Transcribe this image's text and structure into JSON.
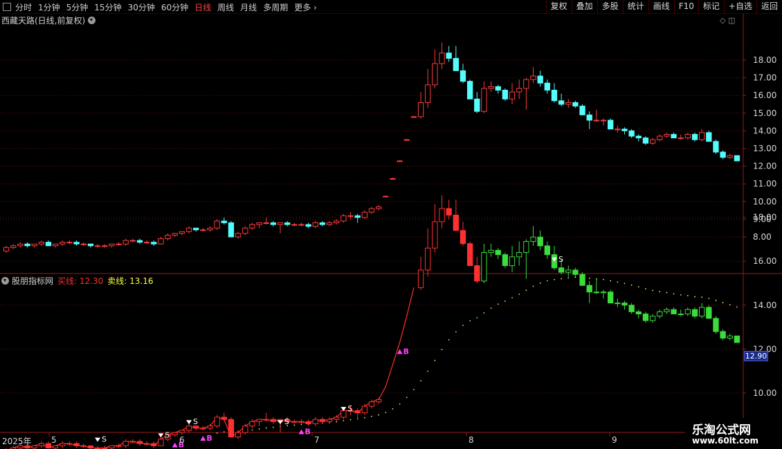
{
  "toolbar": {
    "periods": [
      "分时",
      "1分钟",
      "5分钟",
      "15分钟",
      "30分钟",
      "60分钟",
      "日线",
      "周线",
      "月线",
      "多周期",
      "更多"
    ],
    "active_period": "日线",
    "more_arrow": "›",
    "buttons": [
      "复权",
      "叠加",
      "多股",
      "统计",
      "画线",
      "F10",
      "标记",
      "+自选",
      "返回"
    ]
  },
  "main_panel": {
    "title": "西藏天路(日线,前复权)",
    "icons": [
      "diamond-icon",
      "window-icon"
    ],
    "y_ticks": [
      "18.00",
      "17.00",
      "16.00",
      "15.00",
      "14.00",
      "13.00",
      "12.00",
      "11.00",
      "10.00",
      "9.00",
      "8.00"
    ]
  },
  "indicator_panel": {
    "name": "股朋指标网",
    "buy_label": "买线:",
    "buy_value": "12.30",
    "sell_label": "卖线:",
    "sell_value": "13.16",
    "y_ticks": [
      "18.00",
      "16.00",
      "14.00",
      "12.00",
      "10.00"
    ],
    "current_tag": "12.90",
    "signal_labels": {
      "buy": "B",
      "sell": "S"
    }
  },
  "date_axis": {
    "labels": [
      "2025年",
      "5",
      "6",
      "7",
      "8",
      "9"
    ]
  },
  "watermark": {
    "line1": "乐淘公式网",
    "line2": "www.60lt.com"
  },
  "colors": {
    "up": "#ff3c3c",
    "down": "#54fcfc",
    "ind_up": "#ff3030",
    "ind_down": "#3cdc3c",
    "grid": "#7a1010",
    "signal_buy": "#ff40ff",
    "signal_sell": "#ffffff"
  },
  "chart_data": {
    "type": "candlestick",
    "title": "西藏天路(日线,前复权)",
    "y_range": [
      7.0,
      19.5
    ],
    "ohlc": [
      [
        7.2,
        7.5,
        7.1,
        7.4
      ],
      [
        7.4,
        7.6,
        7.3,
        7.5
      ],
      [
        7.5,
        7.7,
        7.4,
        7.6
      ],
      [
        7.6,
        7.7,
        7.4,
        7.5
      ],
      [
        7.5,
        7.6,
        7.4,
        7.6
      ],
      [
        7.6,
        7.8,
        7.5,
        7.7
      ],
      [
        7.7,
        7.8,
        7.5,
        7.5
      ],
      [
        7.5,
        7.6,
        7.4,
        7.6
      ],
      [
        7.6,
        7.8,
        7.5,
        7.7
      ],
      [
        7.7,
        7.8,
        7.6,
        7.7
      ],
      [
        7.7,
        7.8,
        7.5,
        7.6
      ],
      [
        7.6,
        7.7,
        7.5,
        7.6
      ],
      [
        7.6,
        7.6,
        7.4,
        7.5
      ],
      [
        7.5,
        7.6,
        7.4,
        7.5
      ],
      [
        7.5,
        7.6,
        7.4,
        7.5
      ],
      [
        7.5,
        7.6,
        7.4,
        7.6
      ],
      [
        7.6,
        7.7,
        7.5,
        7.6
      ],
      [
        7.6,
        7.9,
        7.5,
        7.8
      ],
      [
        7.8,
        7.9,
        7.7,
        7.8
      ],
      [
        7.8,
        7.9,
        7.6,
        7.7
      ],
      [
        7.7,
        7.8,
        7.6,
        7.7
      ],
      [
        7.7,
        7.8,
        7.5,
        7.6
      ],
      [
        7.6,
        8.0,
        7.6,
        7.9
      ],
      [
        7.9,
        8.2,
        7.8,
        8.1
      ],
      [
        8.1,
        8.2,
        8.0,
        8.2
      ],
      [
        8.2,
        8.3,
        8.1,
        8.3
      ],
      [
        8.3,
        8.6,
        8.2,
        8.5
      ],
      [
        8.5,
        8.5,
        8.3,
        8.4
      ],
      [
        8.4,
        8.5,
        8.3,
        8.4
      ],
      [
        8.4,
        8.6,
        8.3,
        8.5
      ],
      [
        8.5,
        9.0,
        8.4,
        8.9
      ],
      [
        8.9,
        9.1,
        8.7,
        8.8
      ],
      [
        8.8,
        8.9,
        8.1,
        8.0
      ],
      [
        8.0,
        8.3,
        7.9,
        8.2
      ],
      [
        8.2,
        8.6,
        8.1,
        8.5
      ],
      [
        8.5,
        8.8,
        8.4,
        8.7
      ],
      [
        8.7,
        8.8,
        8.5,
        8.8
      ],
      [
        8.8,
        9.1,
        8.7,
        8.8
      ],
      [
        8.8,
        8.9,
        8.6,
        8.7
      ],
      [
        8.7,
        8.8,
        8.2,
        8.8
      ],
      [
        8.8,
        8.9,
        8.6,
        8.7
      ],
      [
        8.7,
        8.8,
        8.6,
        8.7
      ],
      [
        8.7,
        8.8,
        8.6,
        8.7
      ],
      [
        8.7,
        8.8,
        8.5,
        8.6
      ],
      [
        8.6,
        8.9,
        8.5,
        8.8
      ],
      [
        8.8,
        8.9,
        8.6,
        8.7
      ],
      [
        8.7,
        8.9,
        8.6,
        8.8
      ],
      [
        8.8,
        9.0,
        8.7,
        8.9
      ],
      [
        8.9,
        9.3,
        8.8,
        9.2
      ],
      [
        9.2,
        9.4,
        9.0,
        9.2
      ],
      [
        9.2,
        9.3,
        8.8,
        9.1
      ],
      [
        9.1,
        9.5,
        9.0,
        9.4
      ],
      [
        9.4,
        9.7,
        9.3,
        9.6
      ],
      [
        9.6,
        9.8,
        9.5,
        9.7
      ],
      [
        10.3,
        10.35,
        10.25,
        10.3
      ],
      [
        11.3,
        11.35,
        11.25,
        11.3
      ],
      [
        12.3,
        12.35,
        12.25,
        12.3
      ],
      [
        13.5,
        13.55,
        13.45,
        13.5
      ],
      [
        14.8,
        14.85,
        14.75,
        14.8
      ],
      [
        14.8,
        16.2,
        14.7,
        15.6
      ],
      [
        15.6,
        17.5,
        15.3,
        16.6
      ],
      [
        16.6,
        18.6,
        16.4,
        17.8
      ],
      [
        17.8,
        19.0,
        17.5,
        18.4
      ],
      [
        18.4,
        18.8,
        17.9,
        18.1
      ],
      [
        18.1,
        18.8,
        17.4,
        17.4
      ],
      [
        17.4,
        17.8,
        16.7,
        16.8
      ],
      [
        16.8,
        16.9,
        15.8,
        15.8
      ],
      [
        15.8,
        16.2,
        15.0,
        15.1
      ],
      [
        15.1,
        16.8,
        15.0,
        16.4
      ],
      [
        16.4,
        16.8,
        16.2,
        16.5
      ],
      [
        16.5,
        16.6,
        16.1,
        16.3
      ],
      [
        16.3,
        16.4,
        15.7,
        15.8
      ],
      [
        15.8,
        16.7,
        15.5,
        16.2
      ],
      [
        16.2,
        16.9,
        15.8,
        16.4
      ],
      [
        16.4,
        17.0,
        15.2,
        16.9
      ],
      [
        16.9,
        17.6,
        16.7,
        17.1
      ],
      [
        17.1,
        17.4,
        16.5,
        16.7
      ],
      [
        16.7,
        16.9,
        16.1,
        16.3
      ],
      [
        16.3,
        16.7,
        15.6,
        15.7
      ],
      [
        15.7,
        16.1,
        15.4,
        15.5
      ],
      [
        15.5,
        15.8,
        15.3,
        15.6
      ],
      [
        15.6,
        15.7,
        15.3,
        15.4
      ],
      [
        15.4,
        15.5,
        14.9,
        14.9
      ],
      [
        14.9,
        15.1,
        14.1,
        14.6
      ],
      [
        14.6,
        15.2,
        14.5,
        14.6
      ],
      [
        14.6,
        14.7,
        14.3,
        14.6
      ],
      [
        14.6,
        14.7,
        14.1,
        14.1
      ],
      [
        14.1,
        14.3,
        13.9,
        14.1
      ],
      [
        14.1,
        14.2,
        13.8,
        14.0
      ],
      [
        14.0,
        14.1,
        13.6,
        13.7
      ],
      [
        13.7,
        13.8,
        13.4,
        13.6
      ],
      [
        13.6,
        13.7,
        13.2,
        13.3
      ],
      [
        13.3,
        13.6,
        13.2,
        13.5
      ],
      [
        13.5,
        13.8,
        13.4,
        13.7
      ],
      [
        13.7,
        13.9,
        13.6,
        13.8
      ],
      [
        13.8,
        13.9,
        13.6,
        13.6
      ],
      [
        13.6,
        13.8,
        13.5,
        13.6
      ],
      [
        13.6,
        13.9,
        13.5,
        13.8
      ],
      [
        13.8,
        13.9,
        13.4,
        13.5
      ],
      [
        13.5,
        14.1,
        13.4,
        13.9
      ],
      [
        13.9,
        14.0,
        13.4,
        13.4
      ],
      [
        13.4,
        13.5,
        12.7,
        12.8
      ],
      [
        12.8,
        12.9,
        12.4,
        12.5
      ],
      [
        12.5,
        12.7,
        12.4,
        12.6
      ],
      [
        12.6,
        12.6,
        12.3,
        12.3
      ]
    ],
    "indicator": {
      "buy_line": 12.3,
      "sell_line": 13.16,
      "current": 12.9,
      "sell_signals_at": [
        13,
        22,
        26,
        39,
        48,
        78
      ],
      "buy_signals_at": [
        20,
        24,
        28,
        42,
        56
      ]
    }
  }
}
